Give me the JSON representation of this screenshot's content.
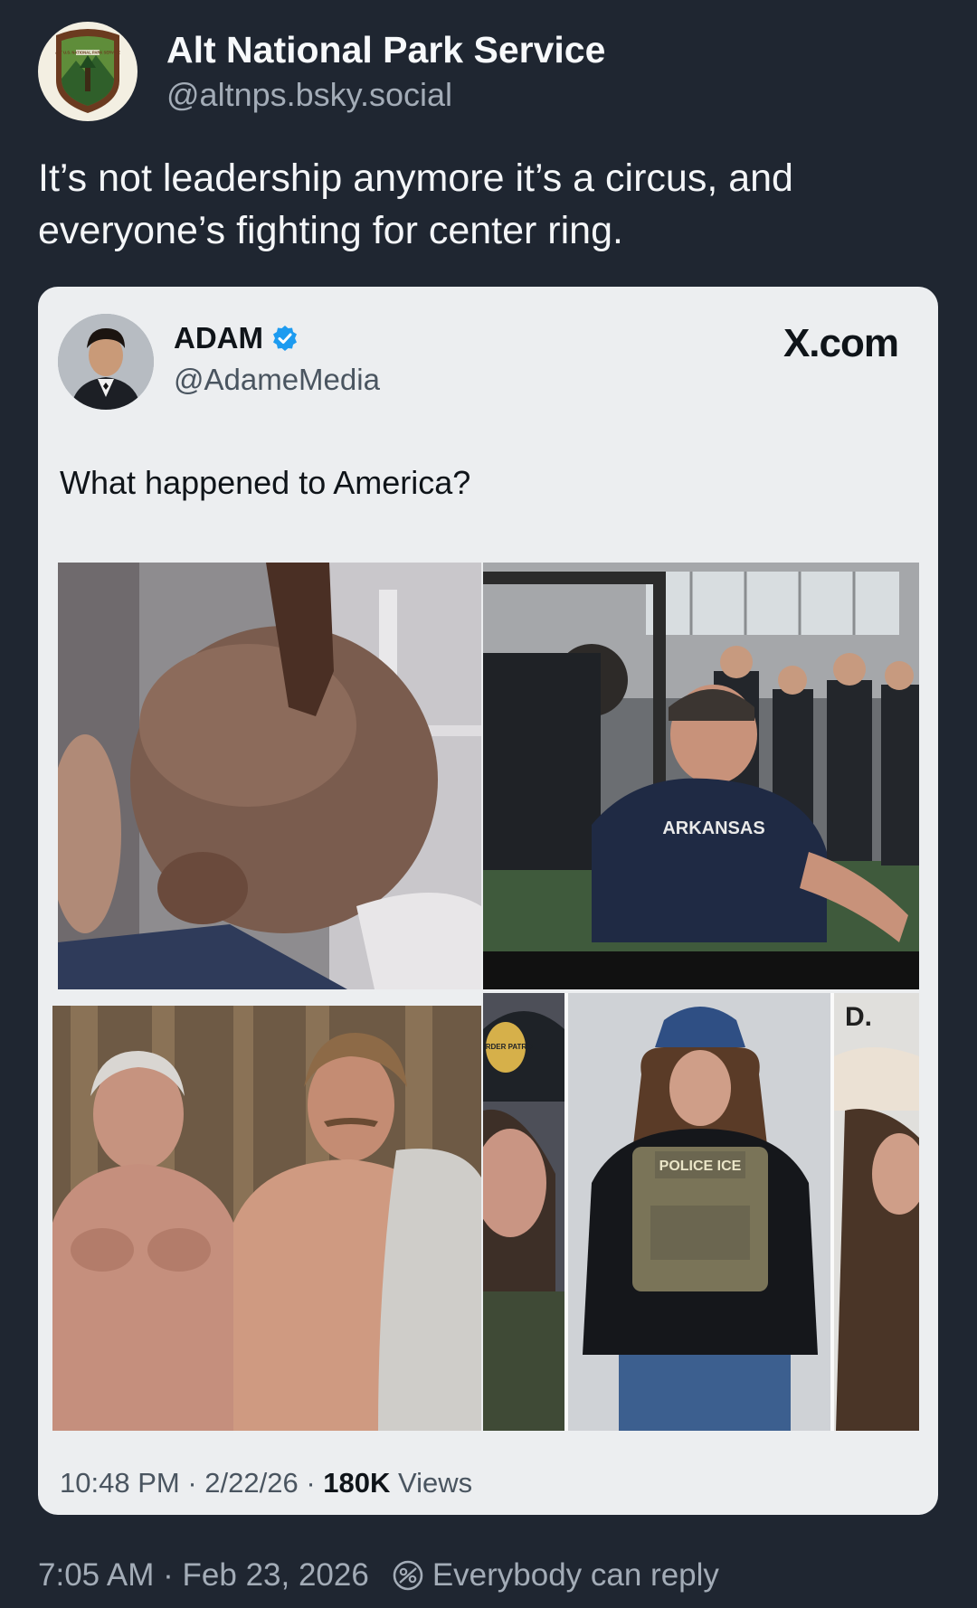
{
  "post": {
    "author_name": "Alt National Park Service",
    "author_handle": "@altnps.bsky.social",
    "text": "It’s not leadership anymore it’s a circus, and everyone’s fighting for center ring.",
    "avatar_icon": "park-service-badge-icon",
    "avatar_text": "ALT U.S. NATIONAL PARK SERVICE"
  },
  "embed": {
    "author_name": "ADAM",
    "author_handle": "@AdameMedia",
    "verified_icon": "verified-badge-icon",
    "source": "X.com",
    "text": "What happened to America?",
    "images": [
      {
        "name": "photo-man-drinking",
        "icon": "photo-icon"
      },
      {
        "name": "photo-man-exercising-gym",
        "icon": "photo-icon",
        "shirt_text": "ARKANSAS"
      },
      {
        "name": "photo-two-shirtless-men",
        "icon": "photo-icon"
      },
      {
        "name": "photo-woman-ice-vest",
        "icon": "photo-icon",
        "cap_text": "BORDER PATROL",
        "vest_text": "POLICE ICE",
        "corner_text": "D."
      }
    ],
    "footer_time": "10:48 PM",
    "footer_sep1": " · ",
    "footer_date": "2/22/26",
    "footer_sep2": " · ",
    "footer_views_count": "180K",
    "footer_views_label": " Views"
  },
  "meta": {
    "time": "7:05 AM",
    "separator": " · ",
    "date": "Feb 23, 2026",
    "reply_icon": "reply-settings-icon",
    "reply_setting": "Everybody can reply"
  },
  "colors": {
    "background": "#1f2631",
    "card_background": "#eceef0",
    "verified_blue": "#1d9bf0",
    "muted_text": "#a3acb7"
  }
}
